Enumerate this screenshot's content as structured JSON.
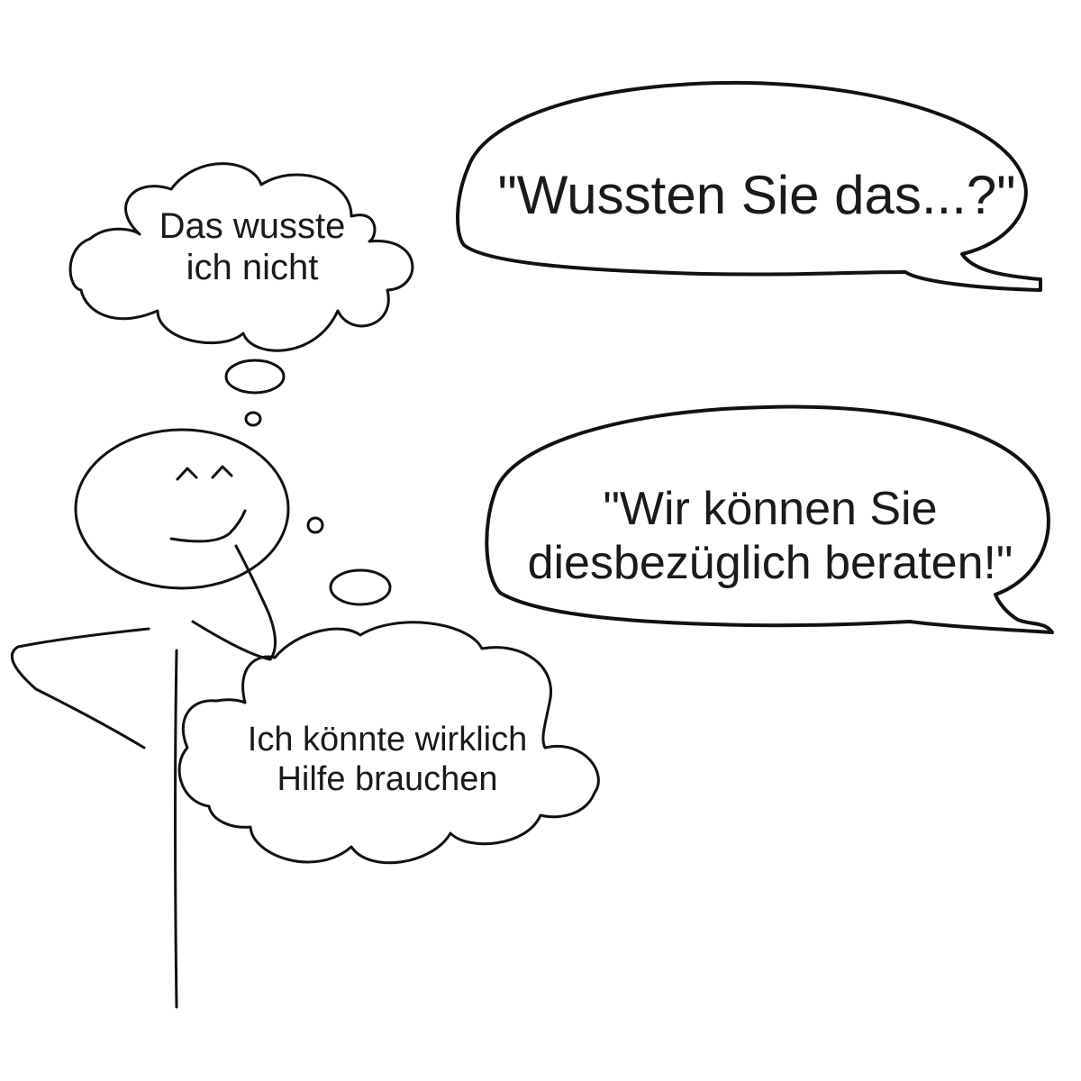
{
  "thought_bubbles": {
    "top": {
      "lines": [
        "Das wusste",
        "ich nicht"
      ]
    },
    "bottom": {
      "lines": [
        "Ich könnte wirklich",
        "Hilfe brauchen"
      ]
    }
  },
  "speech_bubbles": {
    "top": {
      "lines": [
        "\"Wussten Sie das...?\""
      ]
    },
    "bottom": {
      "lines": [
        "\"Wir können Sie",
        "diesbezüglich beraten!\""
      ]
    }
  },
  "colors": {
    "ink": "#111111",
    "background": "#ffffff"
  }
}
